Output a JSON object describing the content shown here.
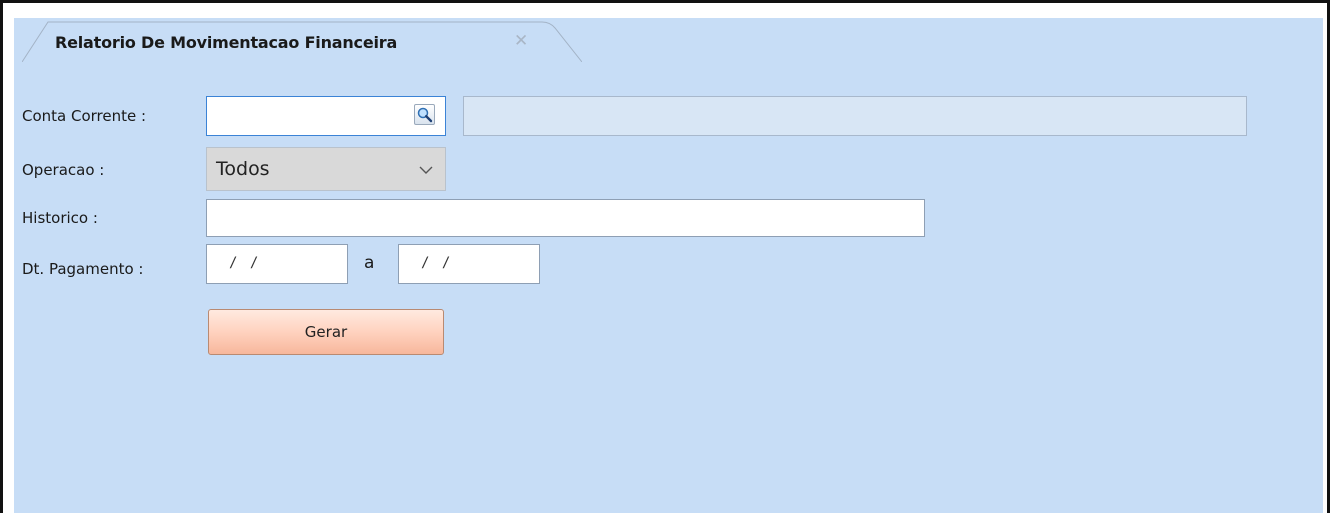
{
  "tab": {
    "title": "Relatorio De Movimentacao Financeira",
    "close_glyph": "✕"
  },
  "form": {
    "conta_corrente": {
      "label": "Conta Corrente :",
      "value": "",
      "description": "",
      "lookup_icon": "search-icon"
    },
    "operacao": {
      "label": "Operacao :",
      "selected": "Todos"
    },
    "historico": {
      "label": "Historico :",
      "value": ""
    },
    "dt_pagamento": {
      "label": "Dt. Pagamento :",
      "from": "/ /",
      "separator": "a",
      "to": "/ /"
    }
  },
  "actions": {
    "gerar_label": "Gerar"
  },
  "colors": {
    "panel_background": "#c7ddf6",
    "button_accent": "#ffd2bf"
  }
}
